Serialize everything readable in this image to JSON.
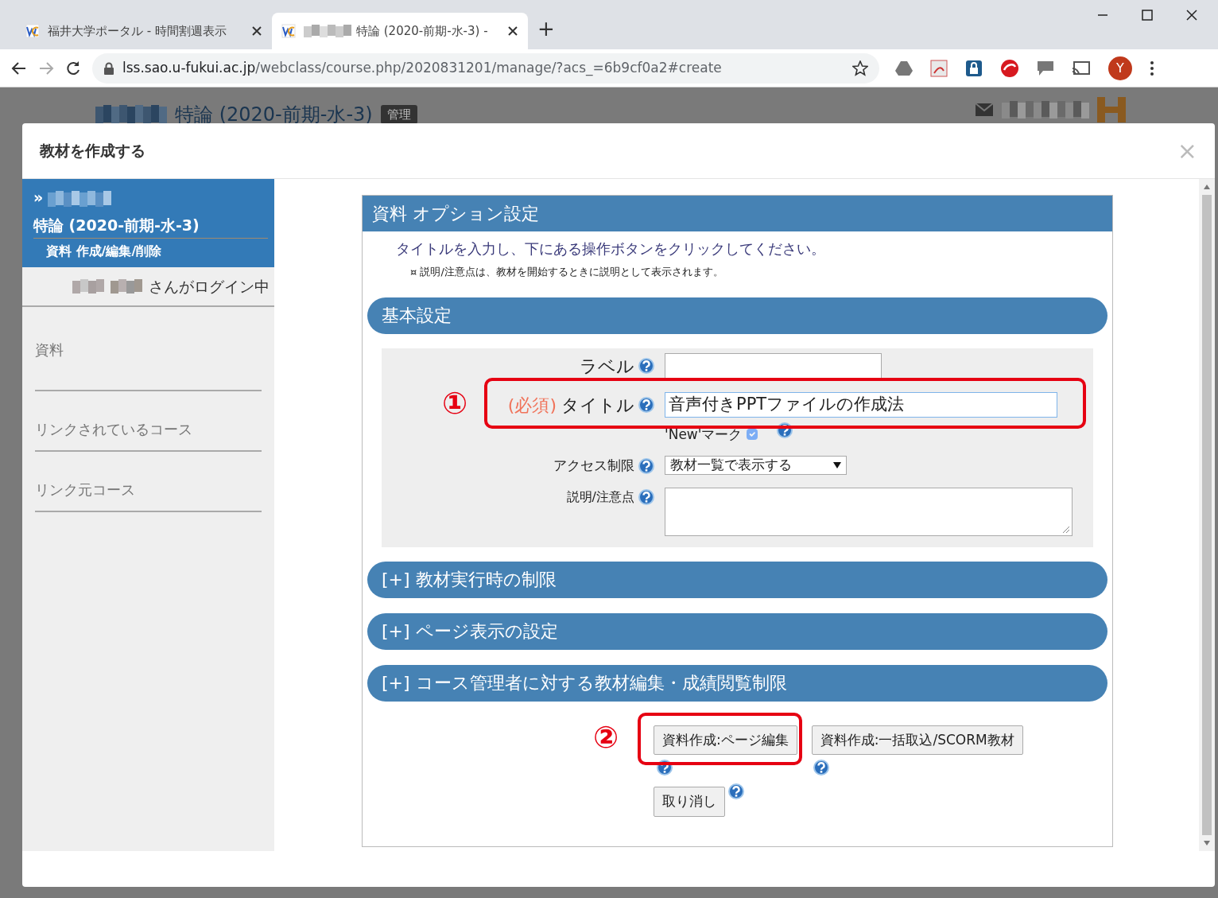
{
  "browser": {
    "tabs": [
      {
        "title": "福井大学ポータル - 時間割週表示",
        "selected": false
      },
      {
        "title": "特論 (2020-前期-水-3) -",
        "selected": true
      }
    ],
    "new_tab": "+",
    "address": {
      "host": "lss.sao.u-fukui.ac.jp",
      "path": "/webclass/course.php/2020831201/manage/?acs_=6b9cf0a2#create"
    },
    "profile": "Y"
  },
  "page": {
    "title": "特論 (2020-前期-水-3)",
    "badge": "管理"
  },
  "dialog": {
    "title": "教材を作成する",
    "close": "×",
    "sidebar": {
      "marker": "»",
      "course": "特論 (2020-前期-水-3)",
      "subtitle": "資料 作成/編集/削除",
      "login": "さんがログイン中",
      "items": [
        {
          "label": "資料"
        },
        {
          "label": "リンクされているコース"
        },
        {
          "label": "リンク元コース"
        }
      ]
    },
    "panel": {
      "title": "資料 オプション設定",
      "instruction": "タイトルを入力し、下にある操作ボタンをクリックしてください。",
      "note": "¤ 説明/注意点は、教材を開始するときに説明として表示されます。",
      "basic": {
        "title": "基本設定",
        "fields": [
          {
            "kind": "text",
            "label": "ラベル"
          },
          {
            "kind": "text",
            "required": "(必須)",
            "label": "タイトル",
            "value": "音声付きPPTファイルの作成法",
            "annotation": "①"
          },
          {
            "kind": "checkbox",
            "label": "'New'マーク",
            "checked": true,
            "disabled": true
          },
          {
            "kind": "select",
            "label": "アクセス制限",
            "value": "教材一覧で表示する"
          },
          {
            "kind": "textarea",
            "label": "説明/注意点"
          }
        ]
      },
      "sections": [
        {
          "title": "[+] 教材実行時の制限"
        },
        {
          "title": "[+] ページ表示の設定"
        },
        {
          "title": "[+] コース管理者に対する教材編集・成績閲覧制限"
        }
      ],
      "buttons": [
        {
          "label": "資料作成:ページ編集",
          "annotation": "②"
        },
        {
          "label": "資料作成:一括取込/SCORM教材"
        }
      ],
      "cancel": "取り消し"
    }
  }
}
